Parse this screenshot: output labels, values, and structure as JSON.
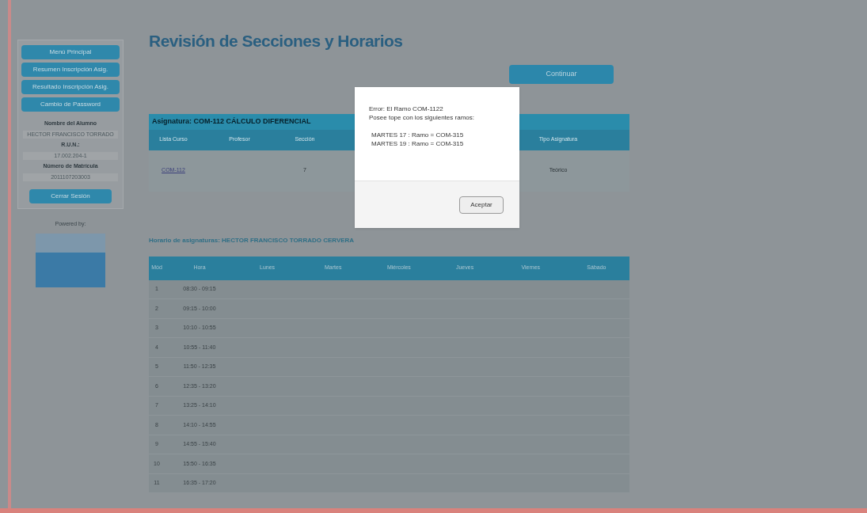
{
  "sidebar": {
    "menu": [
      {
        "label": "Menú Principal"
      },
      {
        "label": "Resumen Inscripción Asig."
      },
      {
        "label": "Resultado Inscripción Asig."
      },
      {
        "label": "Cambio de Password"
      }
    ],
    "student": [
      {
        "kind": "heading",
        "text": "Nombre del Alumno"
      },
      {
        "kind": "value",
        "text": "HECTOR FRANCISCO TORRADO"
      },
      {
        "kind": "heading",
        "text": "R.U.N.:"
      },
      {
        "kind": "value",
        "text": "17.002.204-1"
      },
      {
        "kind": "heading",
        "text": "Número de Matrícula"
      },
      {
        "kind": "value",
        "text": "2011107203003"
      }
    ],
    "logout": "Cerrar Sesión",
    "powered_by": "Powered by:"
  },
  "title": "Revisión de Secciones y Horarios",
  "continue_button": "Continuar",
  "course_table": {
    "caption": "Asignatura: COM-112 CÁLCULO DIFERENCIAL",
    "columns": [
      "Lista Curso",
      "Profesor",
      "Sección",
      "Tipo Asignatura"
    ],
    "rows": [
      [
        "COM-112",
        "",
        "7",
        "Teórico"
      ]
    ]
  },
  "schedule": {
    "caption": "Horario de asignaturas: HECTOR FRANCISCO TORRADO CERVERA",
    "columns": [
      "Mód",
      "Hora",
      "Lunes",
      "Martes",
      "Miércoles",
      "Jueves",
      "Viernes",
      "Sábado"
    ],
    "rows": [
      [
        "1",
        "08:30 - 09:15"
      ],
      [
        "2",
        "09:15 - 10:00"
      ],
      [
        "3",
        "10:10 - 10:55"
      ],
      [
        "4",
        "10:55 - 11:40"
      ],
      [
        "5",
        "11:50 - 12:35"
      ],
      [
        "6",
        "12:35 - 13:20"
      ],
      [
        "7",
        "13:25 - 14:10"
      ],
      [
        "8",
        "14:10 - 14:55"
      ],
      [
        "9",
        "14:55 - 15:40"
      ],
      [
        "10",
        "15:50 - 16:35"
      ],
      [
        "11",
        "16:35 - 17:20"
      ]
    ]
  },
  "dialog": {
    "lines": [
      "Error: El Ramo COM-1122",
      "Posee tope con los siguientes ramos:"
    ],
    "conflicts": [
      "MARTES 17 : Ramo = COM-315",
      "MARTES 19 : Ramo = COM-315"
    ],
    "button": "Aceptar"
  }
}
